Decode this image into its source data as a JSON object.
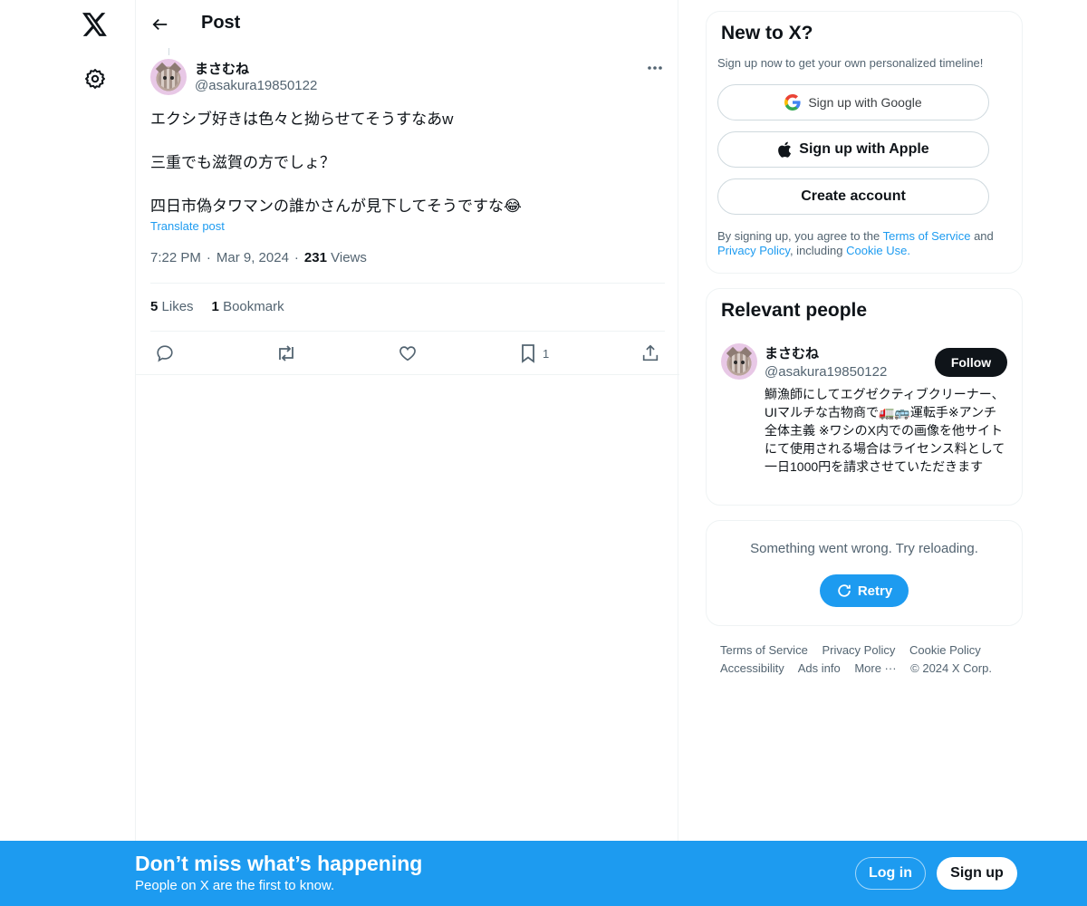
{
  "header": {
    "title": "Post"
  },
  "post": {
    "author_name": "まさむね",
    "author_handle": "@asakura19850122",
    "lines": [
      "エクシブ好きは色々と拗らせてそうすなあw",
      "三重でも滋賀の方でしょ？",
      "四日市偽タワマンの誰かさんが見下してそうですな😂"
    ],
    "translate_label": "Translate post",
    "time": "7:22 PM",
    "date": "Mar 9, 2024",
    "views_count": "231",
    "views_label": "Views",
    "likes_count": "5",
    "likes_label": "Likes",
    "bookmarks_count": "1",
    "bookmarks_label": "Bookmark",
    "bookmark_action_count": "1"
  },
  "signup_card": {
    "title": "New to X?",
    "subtitle": "Sign up now to get your own personalized timeline!",
    "google_label": "Sign up with Google",
    "apple_label": "Sign up with Apple",
    "create_label": "Create account",
    "legal_prefix": "By signing up, you agree to the",
    "terms_link": "Terms of Service",
    "legal_and": "and",
    "privacy_link": "Privacy Policy",
    "legal_including": ", including",
    "cookie_link": "Cookie Use."
  },
  "relevant_people": {
    "title": "Relevant people",
    "name": "まさむね",
    "handle": "@asakura19850122",
    "follow_label": "Follow",
    "bio": "鰤漁師にしてエグゼクティブクリーナー、UIマルチな古物商で🚛🚌運転手※アンチ全体主義 ※ワシのX内での画像を他サイトにて使用される場合はライセンス料として一日1000円を請求させていただきます"
  },
  "error_card": {
    "message": "Something went wrong. Try reloading.",
    "retry_label": "Retry"
  },
  "footer": {
    "links": [
      "Terms of Service",
      "Privacy Policy",
      "Cookie Policy",
      "Accessibility",
      "Ads info",
      "More ···",
      "© 2024 X Corp."
    ]
  },
  "banner": {
    "title": "Don’t miss what’s happening",
    "subtitle": "People on X are the first to know.",
    "login_label": "Log in",
    "signup_label": "Sign up"
  },
  "colors": {
    "accent": "#1d9bf0",
    "text": "#0f1419",
    "muted": "#536471"
  }
}
